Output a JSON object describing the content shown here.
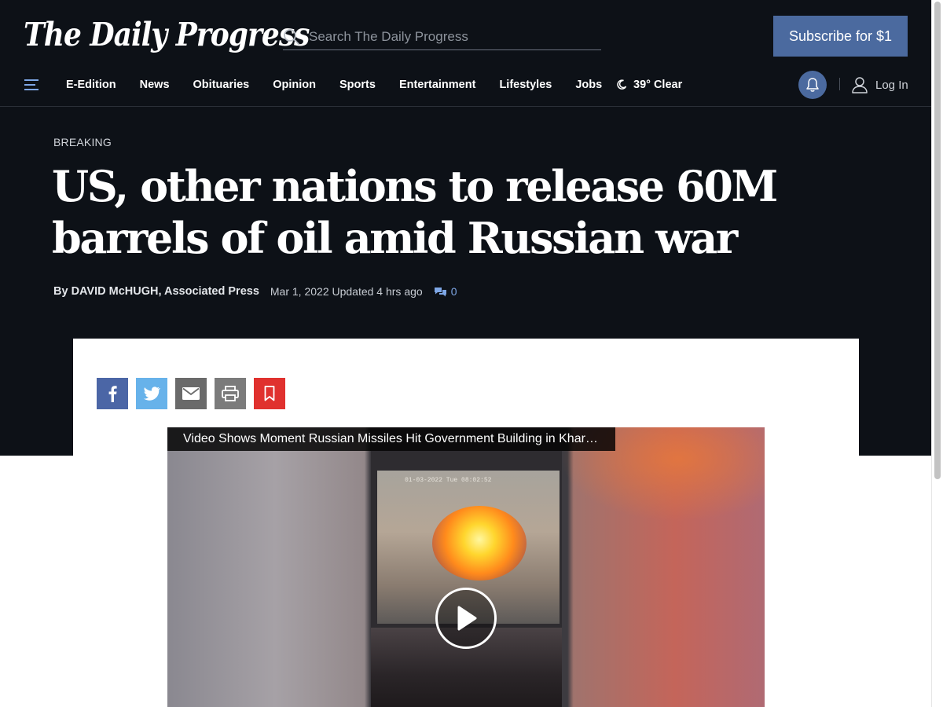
{
  "header": {
    "logo_text": "The Daily Progress",
    "search_placeholder": "Search The Daily Progress",
    "subscribe_label": "Subscribe for $1"
  },
  "nav": {
    "items": [
      "E-Edition",
      "News",
      "Obituaries",
      "Opinion",
      "Sports",
      "Entertainment",
      "Lifestyles",
      "Jobs"
    ],
    "weather": "39° Clear",
    "login_label": "Log In"
  },
  "article": {
    "kicker": "BREAKING",
    "headline": "US, other nations to release 60M barrels of oil amid Russian war",
    "author": "By DAVID McHUGH, Associated Press",
    "dateline": "Mar 1, 2022 Updated 4 hrs ago",
    "comment_count": "0"
  },
  "share": {
    "buttons": [
      "facebook-icon",
      "twitter-icon",
      "email-icon",
      "print-icon",
      "bookmark-icon"
    ]
  },
  "video": {
    "title": "Video Shows Moment Russian Missiles Hit Government Building in Khar…",
    "timestamp_overlay": "01-03-2022 Tue 08:02:52"
  },
  "colors": {
    "background_dark": "#0d1117",
    "accent_blue": "#4b6a9f",
    "facebook": "#4b66a6",
    "twitter": "#67b2ea",
    "bookmark": "#e0312e",
    "comment_link": "#7ea7e6"
  }
}
